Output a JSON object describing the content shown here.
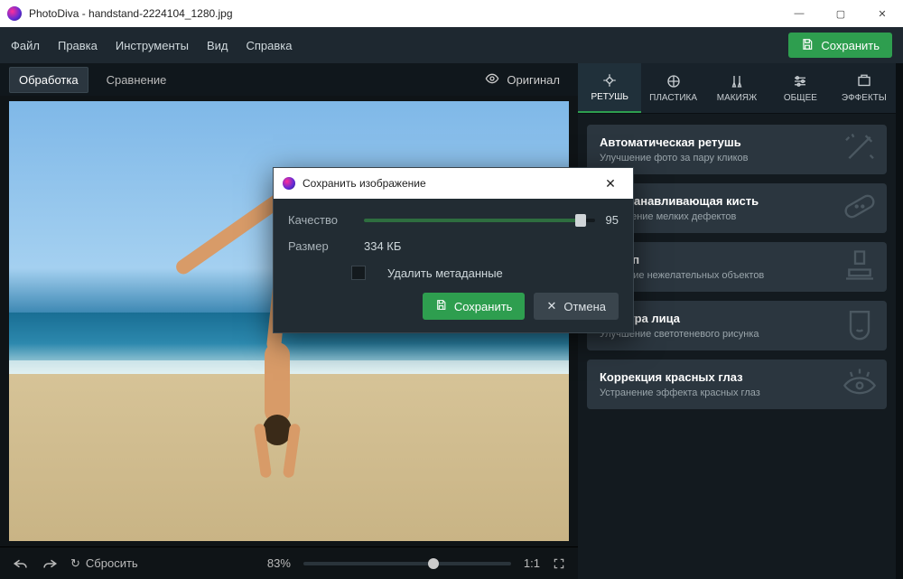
{
  "titlebar": {
    "text": "PhotoDiva - handstand-2224104_1280.jpg"
  },
  "menu": {
    "items": [
      "Файл",
      "Правка",
      "Инструменты",
      "Вид",
      "Справка"
    ]
  },
  "save_button": "Сохранить",
  "tabs": {
    "processing": "Обработка",
    "compare": "Сравнение"
  },
  "original_button": "Оригинал",
  "tools": {
    "retouch": "РЕТУШЬ",
    "liquify": "ПЛАСТИКА",
    "makeup": "МАКИЯЖ",
    "general": "ОБЩЕЕ",
    "effects": "ЭФФЕКТЫ"
  },
  "cards": [
    {
      "title": "Автоматическая ретушь",
      "subtitle": "Улучшение фото за пару кликов"
    },
    {
      "title": "Восстанавливающая кисть",
      "subtitle": "Устранение мелких дефектов"
    },
    {
      "title": "Штамп",
      "subtitle": "Удаление нежелательных объектов"
    },
    {
      "title": "Фактура лица",
      "subtitle": "Улучшение светотеневого рисунка"
    },
    {
      "title": "Коррекция красных глаз",
      "subtitle": "Устранение эффекта красных глаз"
    }
  ],
  "bottom": {
    "reset": "Сбросить",
    "zoom_pct": "83%",
    "one_to_one": "1:1"
  },
  "dialog": {
    "title": "Сохранить изображение",
    "quality_label": "Качество",
    "quality_value": "95",
    "size_label": "Размер",
    "size_value": "334 КБ",
    "delete_meta": "Удалить метаданные",
    "save": "Сохранить",
    "cancel": "Отмена"
  }
}
